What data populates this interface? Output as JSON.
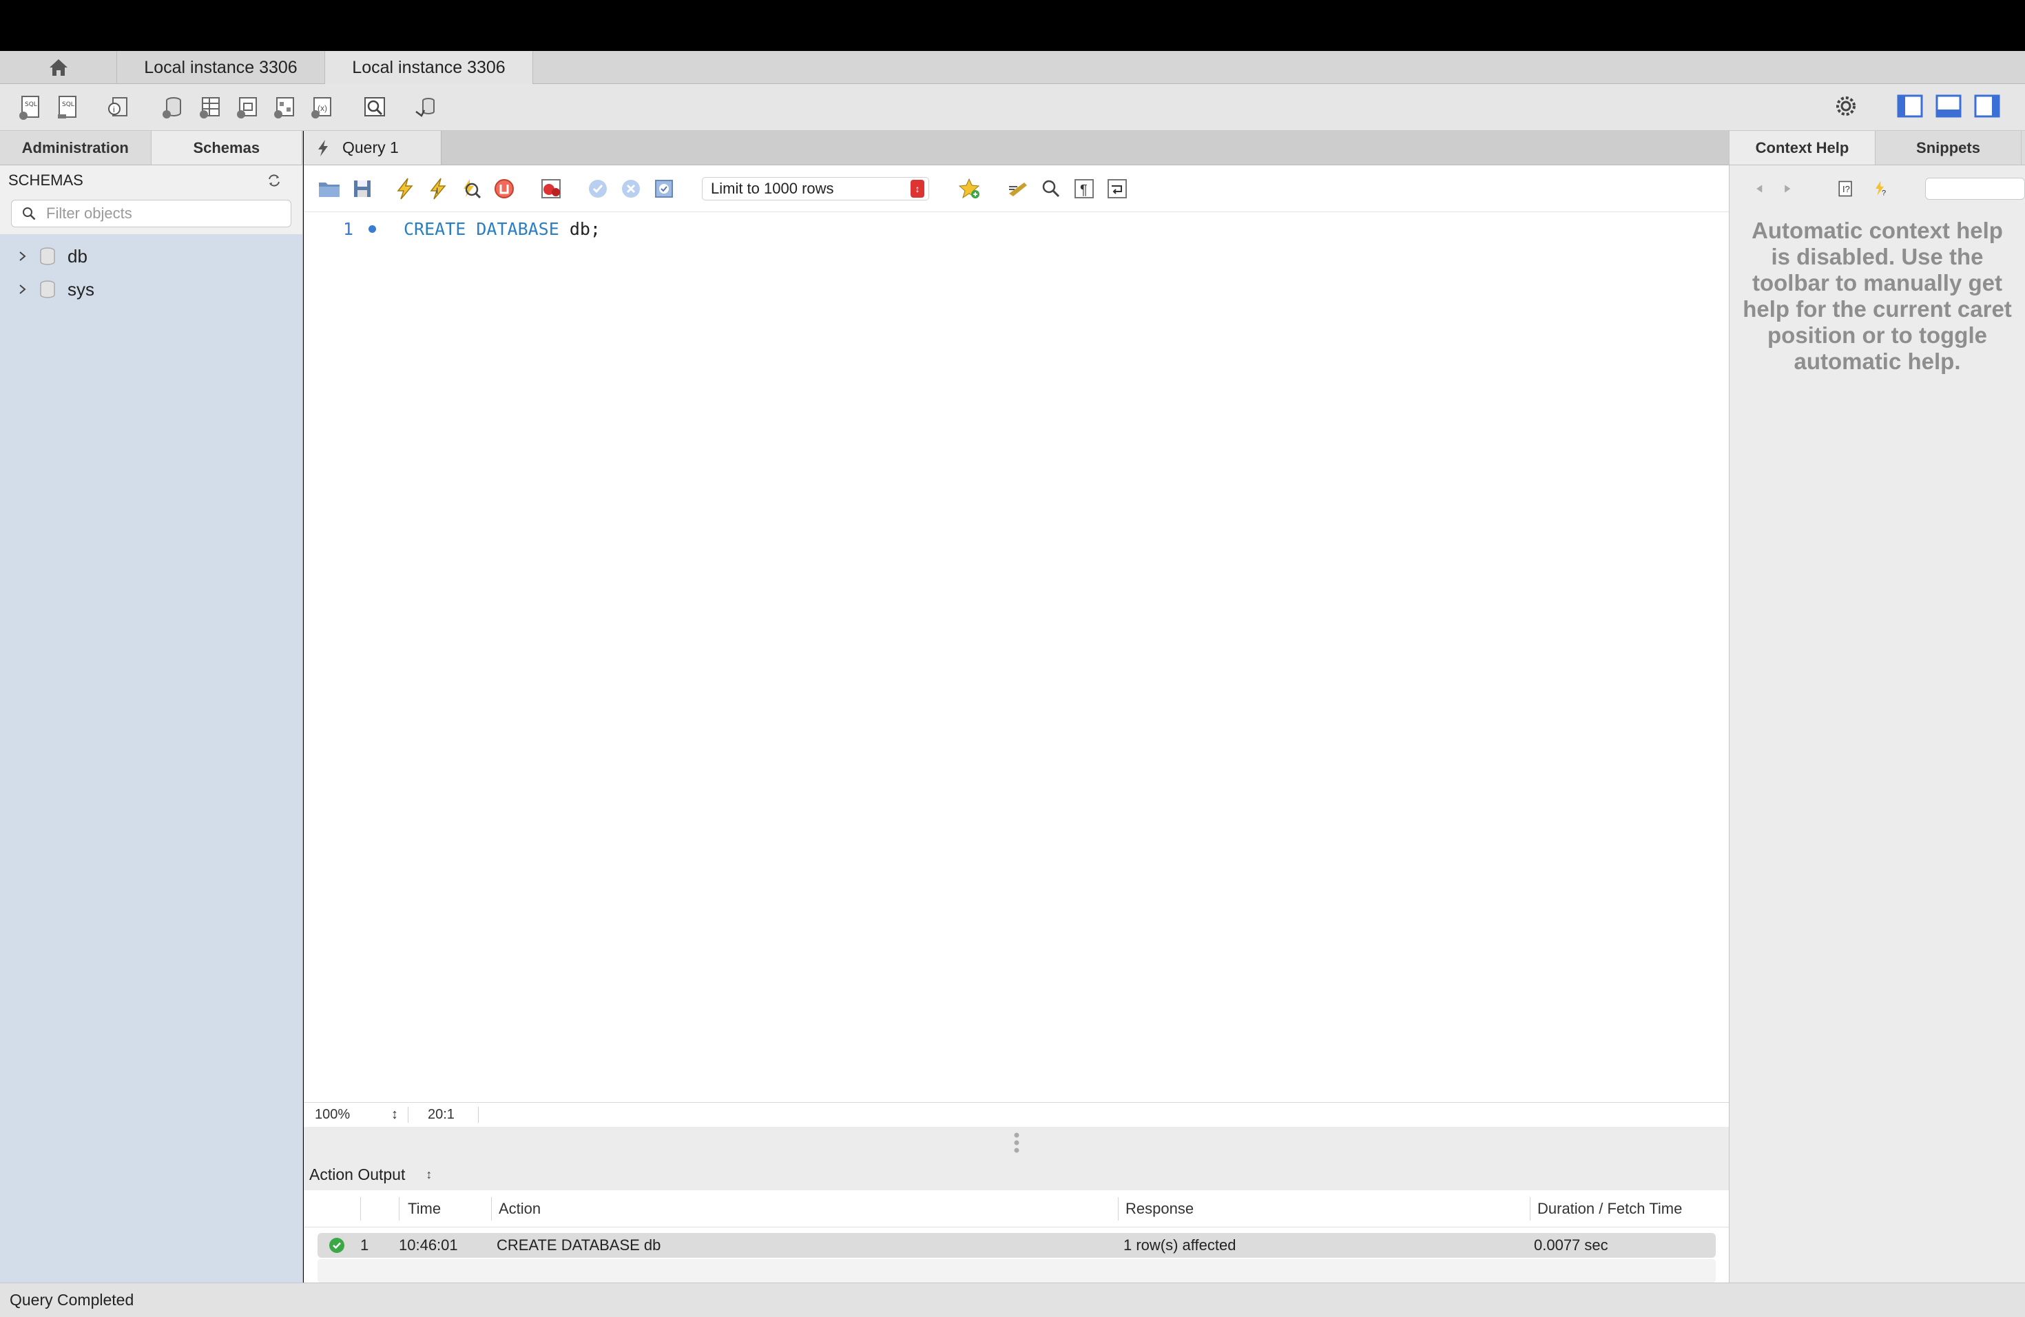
{
  "tabs": {
    "instances": [
      "Local instance 3306",
      "Local instance 3306"
    ]
  },
  "sidebar": {
    "tabs": [
      "Administration",
      "Schemas"
    ],
    "header": "SCHEMAS",
    "filter_placeholder": "Filter objects",
    "schemas": [
      "db",
      "sys"
    ]
  },
  "editor": {
    "tab_label": "Query 1",
    "limit_label": "Limit to 1000 rows",
    "line_number": "1",
    "code_keywords": "CREATE DATABASE",
    "code_rest": " db;",
    "zoom": "100%",
    "caret_position": "20:1"
  },
  "output": {
    "selector": "Action Output",
    "columns": [
      "Time",
      "Action",
      "Response",
      "Duration / Fetch Time"
    ],
    "rows": [
      {
        "index": "1",
        "time": "10:46:01",
        "action": "CREATE DATABASE db",
        "response": "1 row(s) affected",
        "duration": "0.0077 sec",
        "status": "success"
      }
    ]
  },
  "right_panel": {
    "tabs": [
      "Context Help",
      "Snippets"
    ],
    "help_text": "Automatic context help is disabled. Use the toolbar to manually get help for the current caret position or to toggle automatic help."
  },
  "status_bar": {
    "text": "Query Completed"
  },
  "colors": {
    "sidebar_bg": "#d3dde9",
    "keyword": "#2a7fc3",
    "success": "#3aa845",
    "limit_arrow": "#dd3333"
  }
}
